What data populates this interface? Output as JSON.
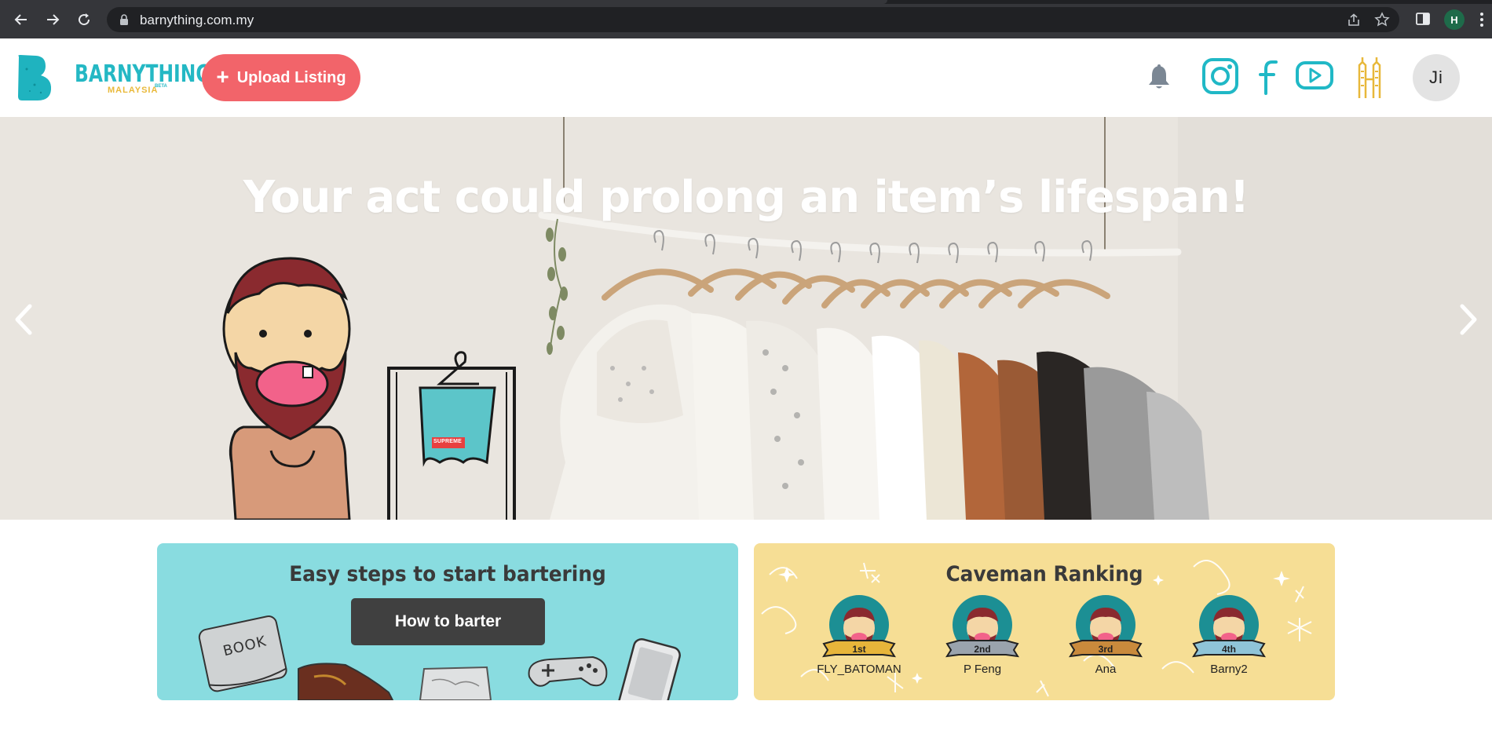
{
  "browser": {
    "url": "barnything.com.my",
    "profile_initial": "H"
  },
  "header": {
    "logo_word": "BARNYTHING",
    "logo_sub": "MALAYSIA",
    "logo_beta": "BETA",
    "upload_label": "Upload Listing",
    "avatar_initials": "Ji"
  },
  "hero": {
    "headline": "Your act could prolong an item’s lifespan!",
    "shirt_tag": "SUPREME"
  },
  "howto": {
    "title": "Easy steps to start bartering",
    "button_label": "How to barter",
    "book_text": "BOOK"
  },
  "ranking": {
    "title": "Caveman Ranking",
    "entries": [
      {
        "place": "1st",
        "name": "FLY_BATOMAN",
        "ribbon": "#e7b53a"
      },
      {
        "place": "2nd",
        "name": "P Feng",
        "ribbon": "#9aa3ad"
      },
      {
        "place": "3rd",
        "name": "Ana",
        "ribbon": "#c98a3c"
      },
      {
        "place": "4th",
        "name": "Barny2",
        "ribbon": "#8fc4d8"
      }
    ]
  },
  "colors": {
    "brand_teal": "#24b8c4",
    "brand_coral": "#f2646a",
    "howto_bg": "#89dce0",
    "ranking_bg": "#f6de95"
  }
}
